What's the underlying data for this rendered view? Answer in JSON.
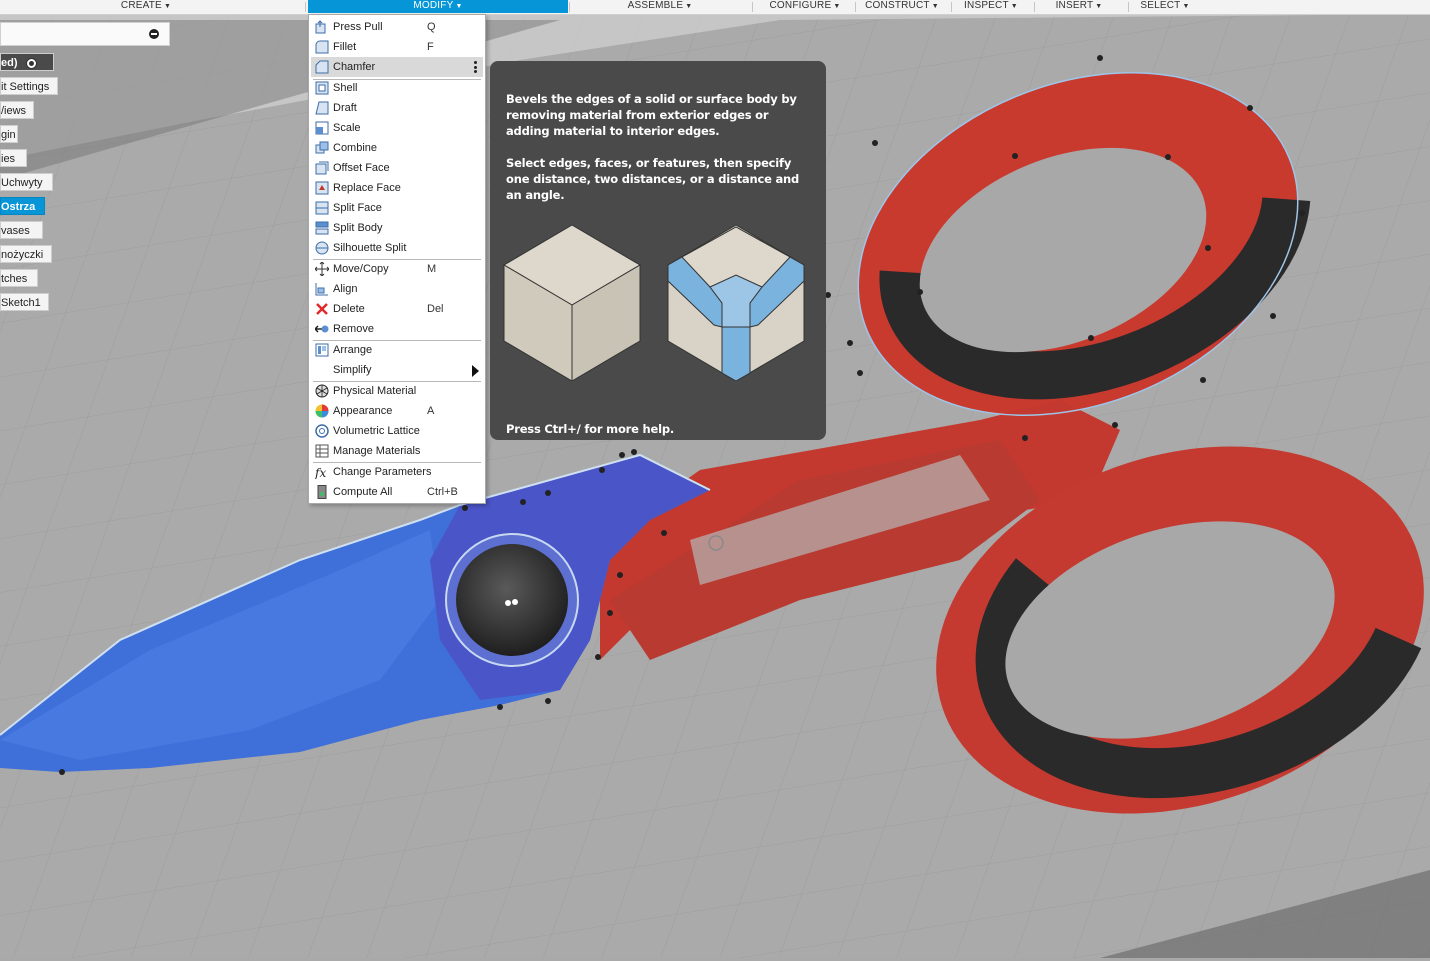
{
  "toolbar": {
    "tabs": [
      {
        "label": "CREATE"
      },
      {
        "label": "MODIFY"
      },
      {
        "label": "ASSEMBLE"
      },
      {
        "label": "CONFIGURE"
      },
      {
        "label": "CONSTRUCT"
      },
      {
        "label": "INSPECT"
      },
      {
        "label": "INSERT"
      },
      {
        "label": "SELECT"
      }
    ],
    "active_tab": "MODIFY",
    "active_color": "#0696d7"
  },
  "browser": {
    "items": [
      {
        "label": "ed)",
        "style": "dark",
        "has_radio": true
      },
      {
        "label": "it Settings"
      },
      {
        "label": "/iews"
      },
      {
        "label": "gin"
      },
      {
        "label": "ies"
      },
      {
        "label": "Uchwyty"
      },
      {
        "label": "Ostrza",
        "style": "selected"
      },
      {
        "label": "vases"
      },
      {
        "label": "nożyczki"
      },
      {
        "label": "tches"
      },
      {
        "label": "Sketch1"
      }
    ]
  },
  "menu": {
    "items": [
      {
        "label": "Press Pull",
        "shortcut": "Q",
        "icon": "press-pull-icon"
      },
      {
        "label": "Fillet",
        "shortcut": "F",
        "icon": "fillet-icon"
      },
      {
        "label": "Chamfer",
        "shortcut": "",
        "icon": "chamfer-icon",
        "highlighted": true
      },
      {
        "label": "Shell",
        "shortcut": "",
        "icon": "shell-icon"
      },
      {
        "label": "Draft",
        "shortcut": "",
        "icon": "draft-icon"
      },
      {
        "label": "Scale",
        "shortcut": "",
        "icon": "scale-icon"
      },
      {
        "label": "Combine",
        "shortcut": "",
        "icon": "combine-icon"
      },
      {
        "label": "Offset Face",
        "shortcut": "",
        "icon": "offset-face-icon"
      },
      {
        "label": "Replace Face",
        "shortcut": "",
        "icon": "replace-face-icon"
      },
      {
        "label": "Split Face",
        "shortcut": "",
        "icon": "split-face-icon"
      },
      {
        "label": "Split Body",
        "shortcut": "",
        "icon": "split-body-icon"
      },
      {
        "label": "Silhouette Split",
        "shortcut": "",
        "icon": "silhouette-split-icon"
      },
      {
        "label": "Move/Copy",
        "shortcut": "M",
        "icon": "move-copy-icon"
      },
      {
        "label": "Align",
        "shortcut": "",
        "icon": "align-icon"
      },
      {
        "label": "Delete",
        "shortcut": "Del",
        "icon": "delete-icon"
      },
      {
        "label": "Remove",
        "shortcut": "",
        "icon": "remove-icon"
      },
      {
        "label": "Arrange",
        "shortcut": "",
        "icon": "arrange-icon"
      },
      {
        "label": "Simplify",
        "shortcut": "",
        "icon": "",
        "submenu": true
      },
      {
        "label": "Physical Material",
        "shortcut": "",
        "icon": "physical-material-icon"
      },
      {
        "label": "Appearance",
        "shortcut": "A",
        "icon": "appearance-icon"
      },
      {
        "label": "Volumetric Lattice",
        "shortcut": "",
        "icon": "volumetric-lattice-icon"
      },
      {
        "label": "Manage Materials",
        "shortcut": "",
        "icon": "manage-materials-icon"
      },
      {
        "label": "Change Parameters",
        "shortcut": "",
        "icon": "fx-icon"
      },
      {
        "label": "Compute All",
        "shortcut": "Ctrl+B",
        "icon": "compute-all-icon"
      }
    ]
  },
  "tooltip": {
    "description": "Bevels the edges of a solid or surface body by removing material from exterior edges or adding material to interior edges.",
    "instructions": "Select edges, faces, or features, then specify one distance, two distances, or a distance and an angle.",
    "help": "Press Ctrl+/ for more help."
  },
  "colors": {
    "handle_red": "#c8392e",
    "grip_dark": "#2a2a2a",
    "blade_blue": "#3f6fd8",
    "canvas_grey": "#a9a9a9"
  }
}
